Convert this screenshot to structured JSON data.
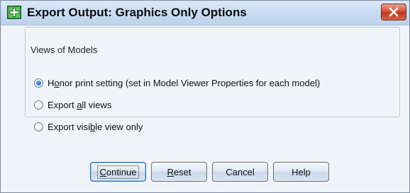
{
  "window": {
    "title": "Export Output: Graphics Only Options",
    "icon": "spss-green-plus-icon",
    "close_icon": "close-x-icon"
  },
  "group": {
    "legend": "Views of Models",
    "options": [
      {
        "pre": "H",
        "u": "o",
        "post": "nor print setting (set in Model Viewer Properties for each model)",
        "checked": true
      },
      {
        "pre": "Export ",
        "u": "a",
        "post": "ll views",
        "checked": false
      },
      {
        "pre": "Export visi",
        "u": "b",
        "post": "le view only",
        "checked": false
      }
    ]
  },
  "buttons": {
    "continue": {
      "pre": "",
      "u": "C",
      "post": "ontinue"
    },
    "reset": {
      "pre": "",
      "u": "R",
      "post": "eset"
    },
    "cancel": {
      "label": "Cancel"
    },
    "help": {
      "label": "Help"
    }
  },
  "colors": {
    "title_gradient_top": "#dae8f8",
    "close_red": "#c0351f",
    "radio_selected": "#1f6fc4"
  }
}
